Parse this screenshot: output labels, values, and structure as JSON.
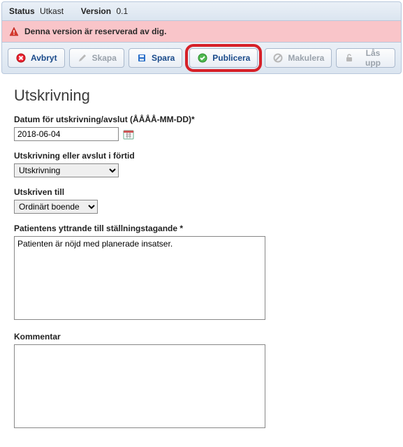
{
  "statusbar": {
    "status_label": "Status",
    "status_value": "Utkast",
    "version_label": "Version",
    "version_value": "0.1"
  },
  "alert": {
    "message": "Denna version är reserverad av dig."
  },
  "toolbar": {
    "avbryt": "Avbryt",
    "skapa": "Skapa",
    "spara": "Spara",
    "publicera": "Publicera",
    "makulera": "Makulera",
    "las_upp": "Lås upp"
  },
  "page": {
    "title": "Utskrivning"
  },
  "fields": {
    "datum": {
      "label": "Datum för utskrivning/avslut (ÅÅÅÅ-MM-DD)*",
      "value": "2018-06-04"
    },
    "fortid": {
      "label": "Utskrivning eller avslut i förtid",
      "value": "Utskrivning"
    },
    "utskriven_till": {
      "label": "Utskriven till",
      "value": "Ordinärt boende"
    },
    "yttrande": {
      "label": "Patientens yttrande till ställningstagande *",
      "value": "Patienten är nöjd med planerade insatser."
    },
    "kommentar": {
      "label": "Kommentar",
      "value": ""
    }
  }
}
